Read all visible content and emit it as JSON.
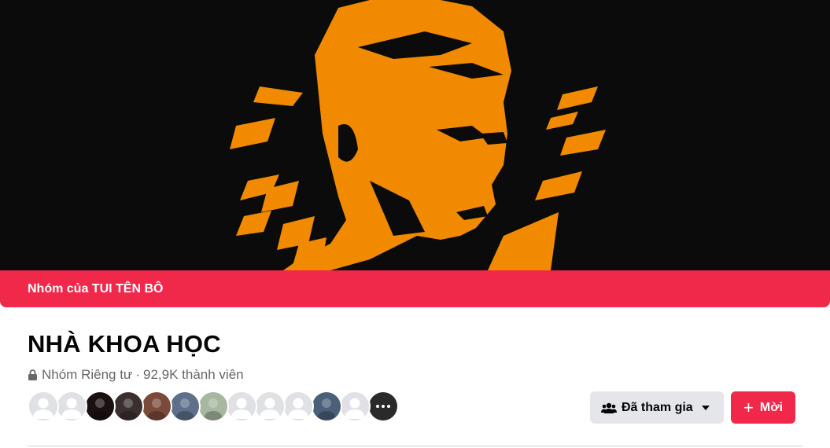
{
  "owner_bar": {
    "text": "Nhóm của TUI TÊN BÔ"
  },
  "group": {
    "name": "NHÀ KHOA HỌC",
    "privacy": "Nhóm Riêng tư",
    "separator": "·",
    "members": "92,9K thành viên"
  },
  "member_avatars": [
    {
      "kind": "default"
    },
    {
      "kind": "default"
    },
    {
      "kind": "photo",
      "color": "#1a1010"
    },
    {
      "kind": "photo",
      "color": "#3b2f2f"
    },
    {
      "kind": "photo",
      "color": "#7a4a3a"
    },
    {
      "kind": "photo",
      "color": "#5d6f8a"
    },
    {
      "kind": "photo",
      "color": "#a7b7a0"
    },
    {
      "kind": "default"
    },
    {
      "kind": "default"
    },
    {
      "kind": "default"
    },
    {
      "kind": "photo",
      "color": "#4a5f7a"
    },
    {
      "kind": "default"
    },
    {
      "kind": "more",
      "color": "#2a2a2a"
    }
  ],
  "actions": {
    "joined_label": "Đã tham gia",
    "invite_label": "Mời"
  },
  "colors": {
    "accent": "#f0284a",
    "cover_bg": "#0b0b0b",
    "cover_art": "#f28a00"
  },
  "icons": [
    "lock-icon",
    "members-icon",
    "caret-down-icon",
    "plus-icon"
  ]
}
